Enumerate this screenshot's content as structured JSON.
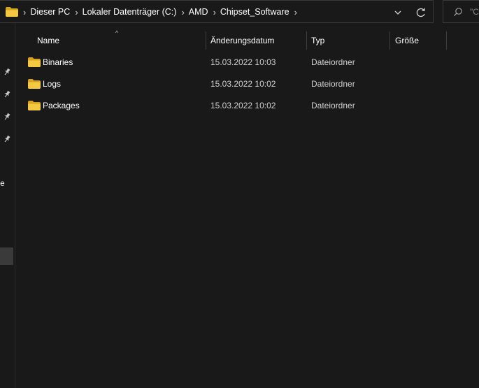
{
  "addressbar": {
    "breadcrumbs": [
      "Dieser PC",
      "Lokaler Datenträger (C:)",
      "AMD",
      "Chipset_Software"
    ]
  },
  "search": {
    "placeholder": "\"C"
  },
  "navpane": {
    "cut_label": "are"
  },
  "columns": {
    "name": "Name",
    "date": "Änderungsdatum",
    "type": "Typ",
    "size": "Größe"
  },
  "files": [
    {
      "name": "Binaries",
      "date": "15.03.2022 10:03",
      "type": "Dateiordner",
      "size": ""
    },
    {
      "name": "Logs",
      "date": "15.03.2022 10:02",
      "type": "Dateiordner",
      "size": ""
    },
    {
      "name": "Packages",
      "date": "15.03.2022 10:02",
      "type": "Dateiordner",
      "size": ""
    }
  ],
  "colors": {
    "background": "#191919",
    "folder_yellow": "#f5c842",
    "border": "#3a3a3a",
    "selected_nav": "#3a3a3a"
  },
  "icons": {
    "folder": "folder-icon",
    "chevron_right": "chevron-right-icon",
    "chevron_down": "chevron-down-icon",
    "refresh": "refresh-icon",
    "search": "search-icon",
    "pin": "pin-icon"
  }
}
